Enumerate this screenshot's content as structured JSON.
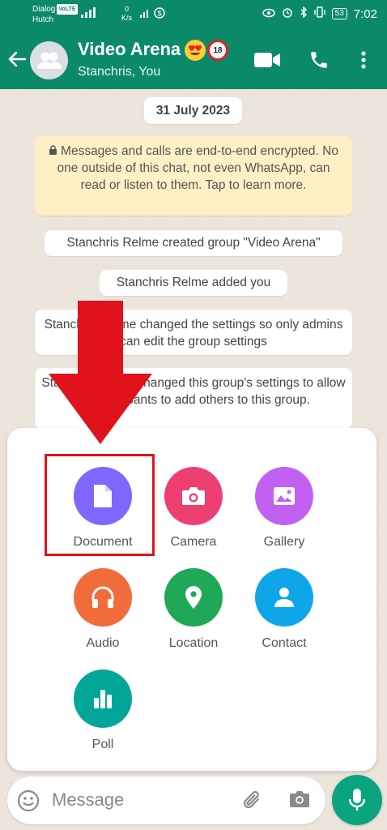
{
  "status_bar": {
    "carrier_line1": "Dialog",
    "carrier_tag": "VoLTE",
    "carrier_line2": "Hutch",
    "net_speed_value": "0",
    "net_speed_unit": "K/s",
    "battery": "53",
    "time": "7:02"
  },
  "header": {
    "title": "Video Arena",
    "title_emoji": [
      "smiling-face-with-heart-eyes",
      "no-one-under-18"
    ],
    "no_under_18_text": "18",
    "subtitle": "Stanchris, You",
    "background_color": "#0b8a69"
  },
  "chat": {
    "date": "31 July 2023",
    "encryption_notice": "Messages and calls are end-to-end encrypted. No one outside of this chat, not even WhatsApp, can read or listen to them. Tap to learn more.",
    "system_messages": [
      "Stanchris Relme created group \"Video Arena\"",
      "Stanchris Relme added you",
      "Stanchris Relme changed the settings so only admins can edit the group settings",
      "Stanchris Relme changed this group's settings to allow all participants to add others to this group."
    ]
  },
  "attachments": [
    {
      "label": "Document",
      "icon": "document-icon",
      "color": "#7f66ff"
    },
    {
      "label": "Camera",
      "icon": "camera-icon",
      "color": "#ee3f71"
    },
    {
      "label": "Gallery",
      "icon": "gallery-icon",
      "color": "#c261f1"
    },
    {
      "label": "Audio",
      "icon": "headphones-icon",
      "color": "#f26b3a"
    },
    {
      "label": "Location",
      "icon": "location-pin-icon",
      "color": "#1fa855"
    },
    {
      "label": "Contact",
      "icon": "contact-icon",
      "color": "#0ea5e9"
    },
    {
      "label": "Poll",
      "icon": "poll-icon",
      "color": "#02a698"
    }
  ],
  "annotation": {
    "color": "#e0121b",
    "target": "Document"
  },
  "input": {
    "placeholder": "Message"
  }
}
